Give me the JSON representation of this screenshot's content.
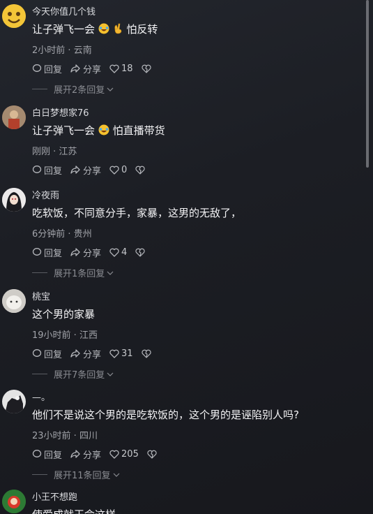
{
  "comments": [
    {
      "username": "今天你值几个钱",
      "text_before": "让子弹飞一会",
      "text_after": "怕反转",
      "emoji": [
        "laughing-crying",
        "ok-hand"
      ],
      "time": "2小时前",
      "location": "云南",
      "reply_label": "回复",
      "share_label": "分享",
      "likes": "18",
      "expand_label": "展开2条回复"
    },
    {
      "username": "白日梦想家76",
      "text_before": "让子弹飞一会",
      "text_after": "怕直播带货",
      "emoji": [
        "laughing-crying"
      ],
      "time": "刚刚",
      "location": "江苏",
      "reply_label": "回复",
      "share_label": "分享",
      "likes": "0"
    },
    {
      "username": "冷夜雨",
      "text": "吃软饭，不同意分手，家暴，这男的无敌了，",
      "time": "6分钟前",
      "location": "贵州",
      "reply_label": "回复",
      "share_label": "分享",
      "likes": "4",
      "expand_label": "展开1条回复"
    },
    {
      "username": "桃宝",
      "text": "这个男的家暴",
      "time": "19小时前",
      "location": "江西",
      "reply_label": "回复",
      "share_label": "分享",
      "likes": "31",
      "expand_label": "展开7条回复"
    },
    {
      "username": "—。",
      "text": "他们不是说这个男的是吃软饭的，这个男的是诬陷别人吗?",
      "time": "23小时前",
      "location": "四川",
      "reply_label": "回复",
      "share_label": "分享",
      "likes": "205",
      "expand_label": "展开11条回复"
    },
    {
      "username": "小王不想跑",
      "text": "使爱成就王命这样"
    }
  ],
  "meta_separator": " · ",
  "colors": {
    "background": "#1c1e24",
    "text": "#f3f3f5",
    "muted": "#a2a4aa"
  }
}
